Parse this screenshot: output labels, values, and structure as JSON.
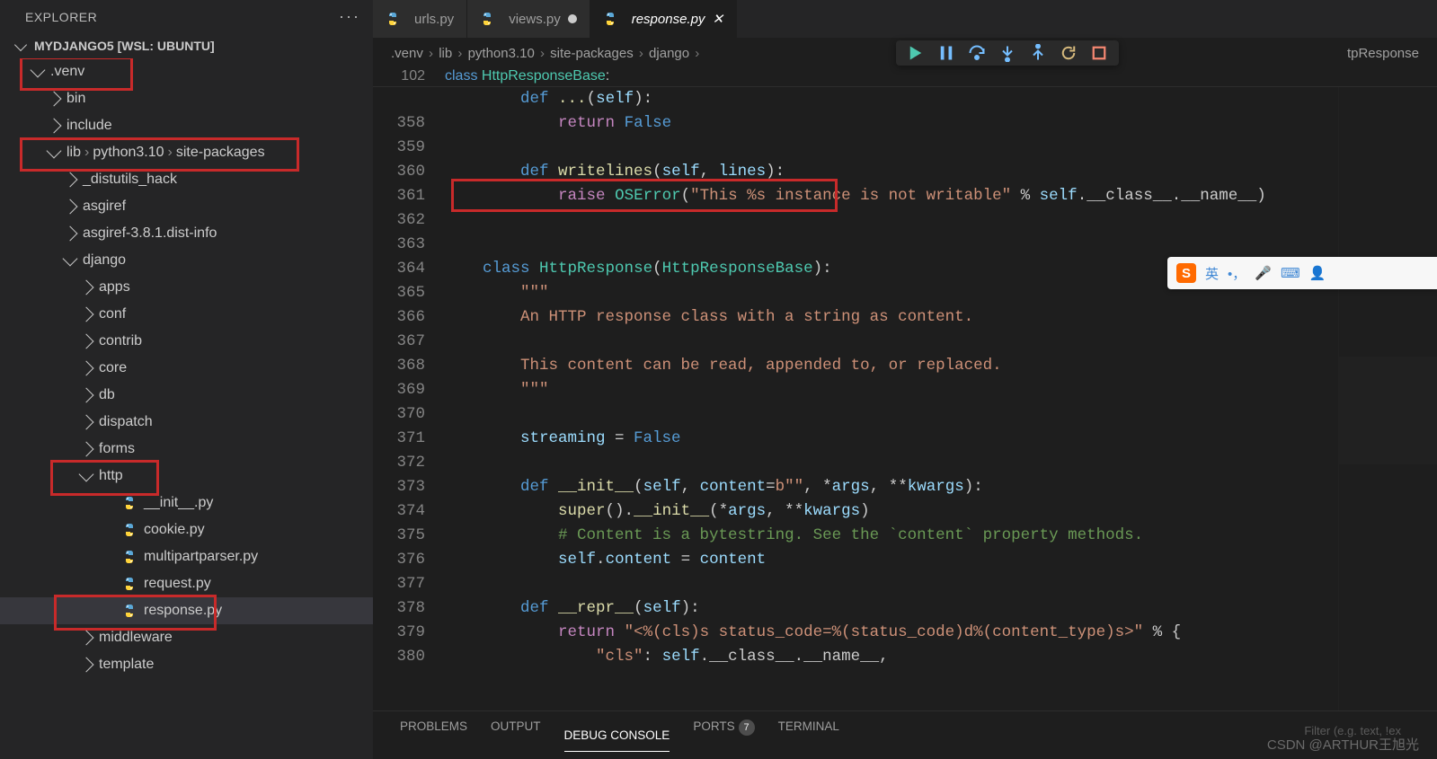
{
  "sidebar": {
    "title": "EXPLORER",
    "root": "MYDJANGO5 [WSL: UBUNTU]",
    "tree": [
      {
        "d": 1,
        "tw": "open",
        "label": ".venv",
        "hl": "hl1"
      },
      {
        "d": 2,
        "tw": "closed",
        "label": "bin"
      },
      {
        "d": 2,
        "tw": "closed",
        "label": "include"
      },
      {
        "d": 2,
        "tw": "open",
        "label": "lib / python3.10 / site-packages",
        "path": true,
        "hl": "hl2"
      },
      {
        "d": 3,
        "tw": "closed",
        "label": "_distutils_hack"
      },
      {
        "d": 3,
        "tw": "closed",
        "label": "asgiref"
      },
      {
        "d": 3,
        "tw": "closed",
        "label": "asgiref-3.8.1.dist-info"
      },
      {
        "d": 3,
        "tw": "open",
        "label": "django"
      },
      {
        "d": 4,
        "tw": "closed",
        "label": "apps"
      },
      {
        "d": 4,
        "tw": "closed",
        "label": "conf"
      },
      {
        "d": 4,
        "tw": "closed",
        "label": "contrib"
      },
      {
        "d": 4,
        "tw": "closed",
        "label": "core"
      },
      {
        "d": 4,
        "tw": "closed",
        "label": "db"
      },
      {
        "d": 4,
        "tw": "closed",
        "label": "dispatch"
      },
      {
        "d": 4,
        "tw": "closed",
        "label": "forms"
      },
      {
        "d": 4,
        "tw": "open",
        "label": "http",
        "hl": "hl3"
      },
      {
        "d": 5,
        "tw": "none",
        "icon": "py",
        "label": "__init__.py"
      },
      {
        "d": 5,
        "tw": "none",
        "icon": "py",
        "label": "cookie.py"
      },
      {
        "d": 5,
        "tw": "none",
        "icon": "py",
        "label": "multipartparser.py"
      },
      {
        "d": 5,
        "tw": "none",
        "icon": "py",
        "label": "request.py"
      },
      {
        "d": 5,
        "tw": "none",
        "icon": "py",
        "label": "response.py",
        "selected": true,
        "hl": "hl4"
      },
      {
        "d": 4,
        "tw": "closed",
        "label": "middleware"
      },
      {
        "d": 4,
        "tw": "closed",
        "label": "template"
      }
    ]
  },
  "tabs": [
    {
      "label": "urls.py",
      "icon": "py",
      "state": "clean"
    },
    {
      "label": "views.py",
      "icon": "py",
      "state": "dirty"
    },
    {
      "label": "response.py",
      "icon": "py",
      "state": "active"
    }
  ],
  "breadcrumb": {
    "segments": [
      ".venv",
      "lib",
      "python3.10",
      "site-packages",
      "django"
    ],
    "tail": "tpResponse"
  },
  "sticky": {
    "gutter": "102",
    "html": "<span class='kw2'>class</span> <span class='cls'>HttpResponseBase</span>:"
  },
  "code": [
    {
      "n": "",
      "html": "        <span class='kw2'>def</span> <span class='fn'>...</span>(<span class='self'>self</span>):"
    },
    {
      "n": "358",
      "html": "            <span class='kw'>return</span> <span class='kw2'>False</span>"
    },
    {
      "n": "359",
      "html": ""
    },
    {
      "n": "360",
      "html": "        <span class='kw2'>def</span> <span class='fn'>writelines</span>(<span class='self'>self</span>, <span class='var'>lines</span>):"
    },
    {
      "n": "361",
      "html": "            <span class='kw'>raise</span> <span class='cls'>OSError</span>(<span class='str'>\"This %s instance is not writable\"</span> % <span class='self'>self</span>.__class__.__name__)"
    },
    {
      "n": "362",
      "html": ""
    },
    {
      "n": "363",
      "html": ""
    },
    {
      "n": "364",
      "html": "    <span class='kw2'>class</span> <span class='cls'>HttpResponse</span>(<span class='cls'>HttpResponseBase</span>):"
    },
    {
      "n": "365",
      "html": "        <span class='str'>\"\"\"</span>"
    },
    {
      "n": "366",
      "html": "<span class='str'>        An HTTP response class with a string as content.</span>"
    },
    {
      "n": "367",
      "html": ""
    },
    {
      "n": "368",
      "html": "<span class='str'>        This content can be read, appended to, or replaced.</span>"
    },
    {
      "n": "369",
      "html": "<span class='str'>        \"\"\"</span>"
    },
    {
      "n": "370",
      "html": ""
    },
    {
      "n": "371",
      "html": "        <span class='var'>streaming</span> = <span class='kw2'>False</span>"
    },
    {
      "n": "372",
      "html": ""
    },
    {
      "n": "373",
      "html": "        <span class='kw2'>def</span> <span class='fn'>__init__</span>(<span class='self'>self</span>, <span class='var'>content</span>=<span class='str'>b\"\"</span>, *<span class='var'>args</span>, **<span class='var'>kwargs</span>):"
    },
    {
      "n": "374",
      "html": "            <span class='fn'>super</span>().<span class='fn'>__init__</span>(*<span class='var'>args</span>, **<span class='var'>kwargs</span>)"
    },
    {
      "n": "375",
      "html": "            <span class='cmt'># Content is a bytestring. See the `content` property methods.</span>"
    },
    {
      "n": "376",
      "html": "            <span class='self'>self</span>.<span class='var'>content</span> = <span class='var'>content</span>"
    },
    {
      "n": "377",
      "html": ""
    },
    {
      "n": "378",
      "html": "        <span class='kw2'>def</span> <span class='fn'>__repr__</span>(<span class='self'>self</span>):"
    },
    {
      "n": "379",
      "html": "            <span class='kw'>return</span> <span class='str'>\"&lt;%(cls)s status_code=%(status_code)d%(content_type)s&gt;\"</span> % {"
    },
    {
      "n": "380",
      "html": "                <span class='str'>\"cls\"</span>: <span class='self'>self</span>.__class__.__name__,"
    }
  ],
  "panel": {
    "tabs": [
      {
        "label": "PROBLEMS"
      },
      {
        "label": "OUTPUT"
      },
      {
        "label": "DEBUG CONSOLE",
        "active": true
      },
      {
        "label": "PORTS",
        "badge": "7"
      },
      {
        "label": "TERMINAL"
      }
    ],
    "filter_ph": "Filter (e.g. text, !ex"
  },
  "watermark": "CSDN @ARTHUR王旭光",
  "ime": {
    "lang": "英",
    "punct": "•，"
  }
}
